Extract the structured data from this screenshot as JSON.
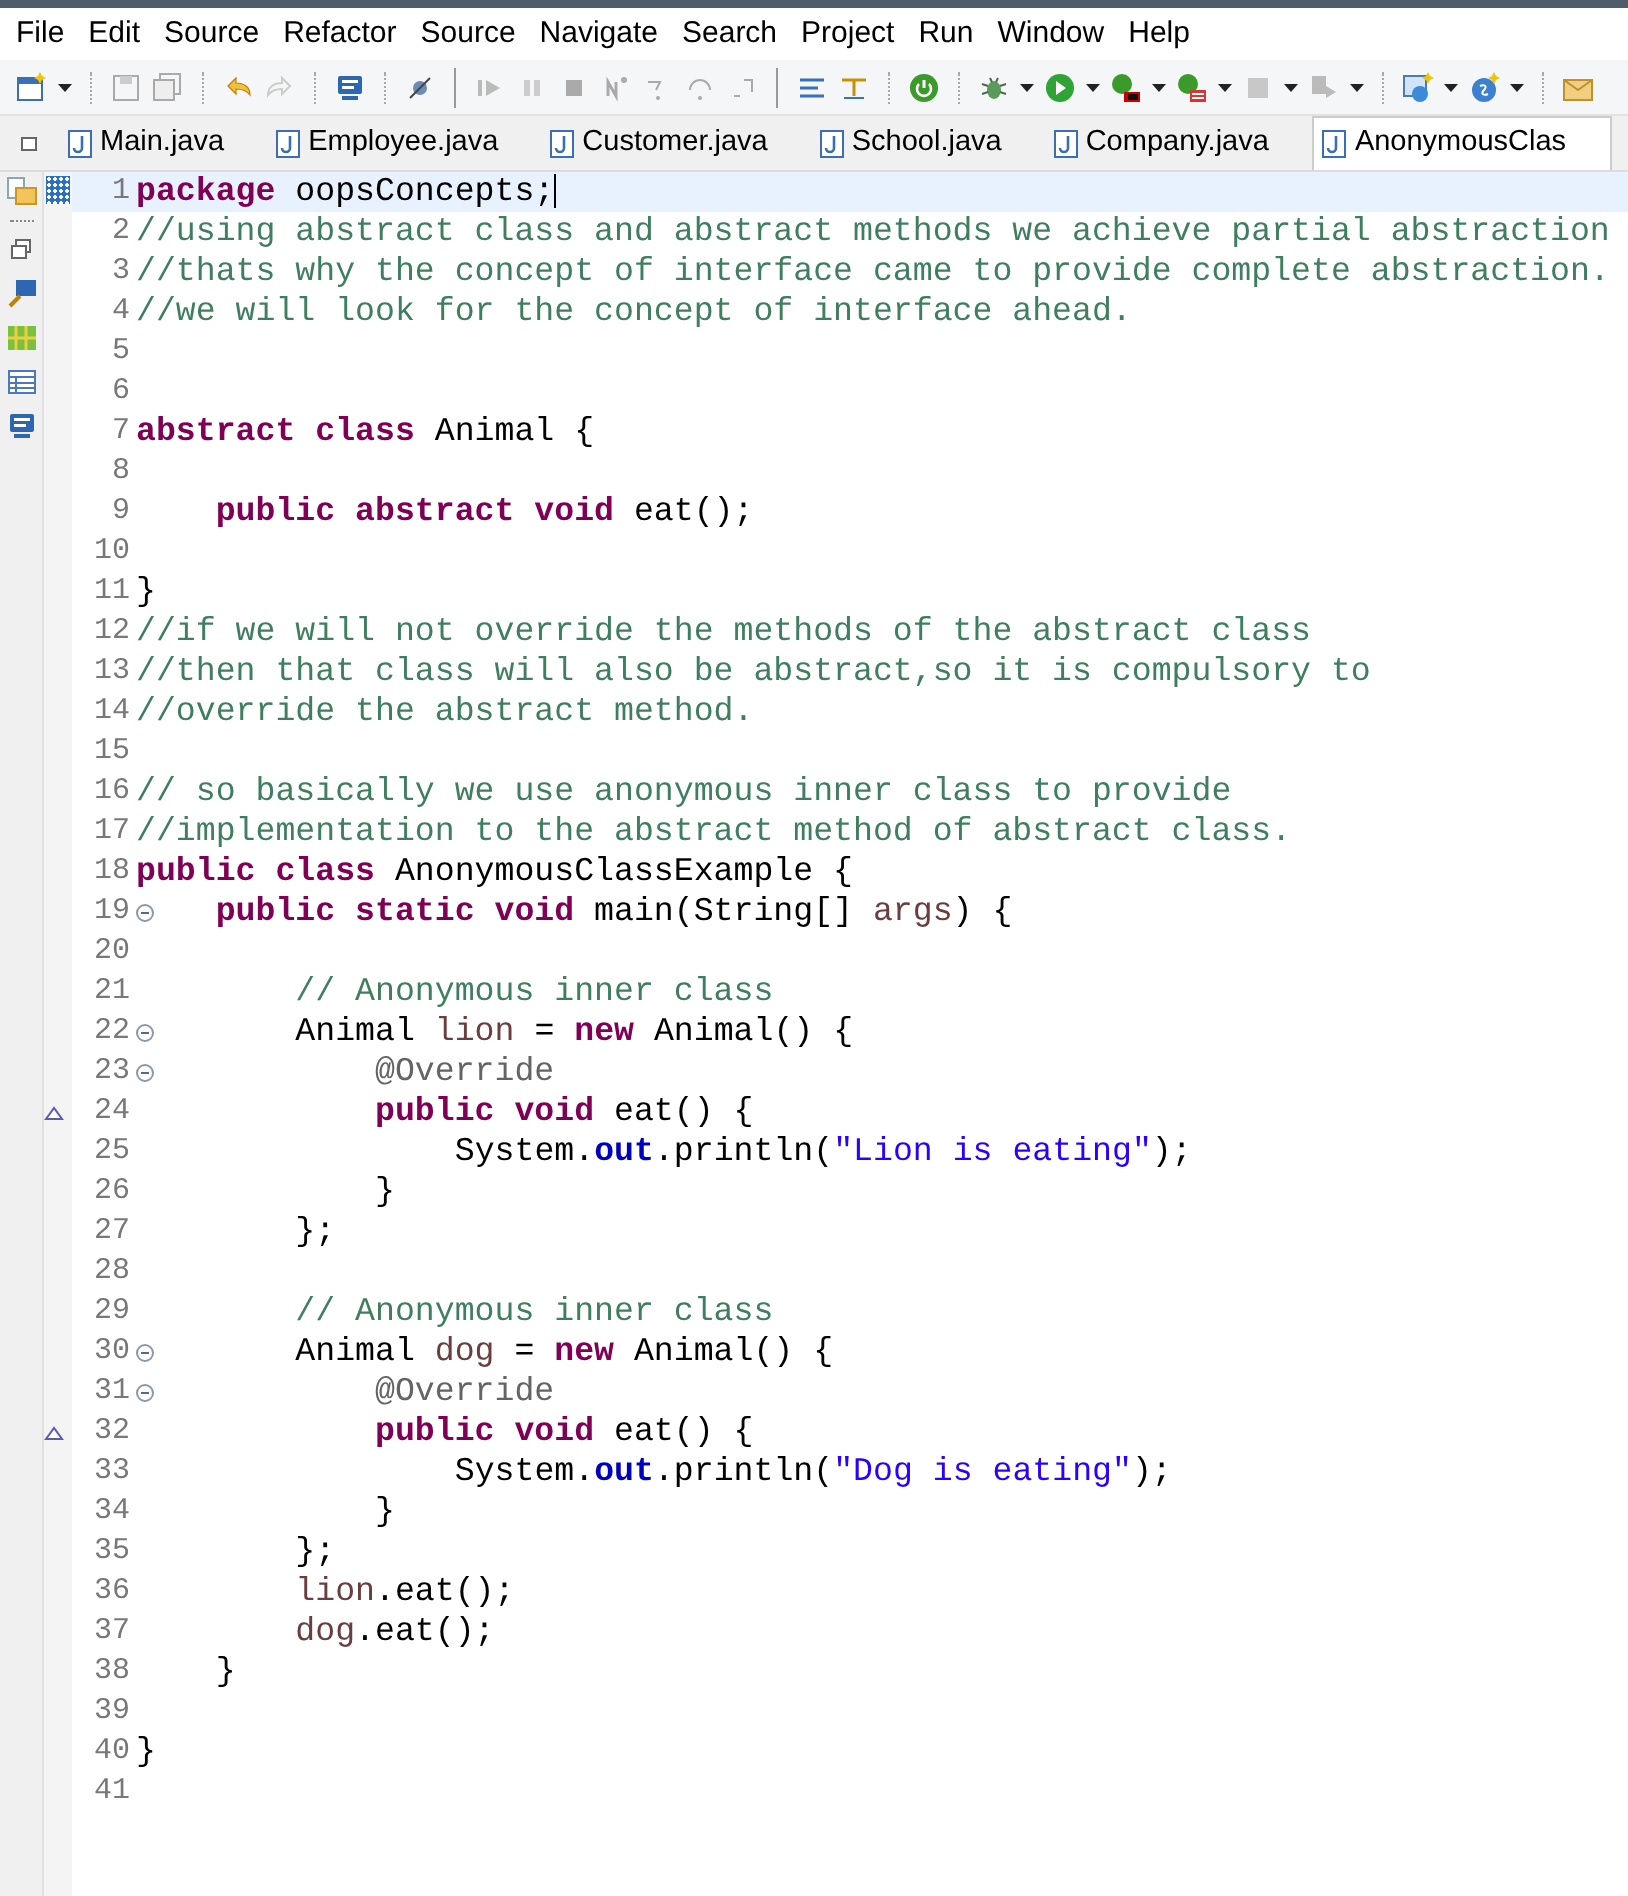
{
  "menu": [
    "File",
    "Edit",
    "Source",
    "Refactor",
    "Source",
    "Navigate",
    "Search",
    "Project",
    "Run",
    "Window",
    "Help"
  ],
  "tabs": [
    {
      "label": "Main.java",
      "selected": false
    },
    {
      "label": "Employee.java",
      "selected": false
    },
    {
      "label": "Customer.java",
      "selected": false
    },
    {
      "label": "School.java",
      "selected": false
    },
    {
      "label": "Company.java",
      "selected": false
    },
    {
      "label": "AnonymousClas",
      "selected": true
    }
  ],
  "editor": {
    "lines": [
      {
        "number": "1",
        "current": true,
        "foldable": false,
        "overrides": false,
        "tokens": [
          {
            "kind": "keyword",
            "text": "package"
          },
          {
            "kind": "plain",
            "text": " oopsConcepts;"
          }
        ]
      },
      {
        "number": "2",
        "current": false,
        "foldable": false,
        "overrides": false,
        "tokens": [
          {
            "kind": "comment",
            "text": "//using abstract class and abstract methods we achieve partial abstraction"
          }
        ]
      },
      {
        "number": "3",
        "current": false,
        "foldable": false,
        "overrides": false,
        "tokens": [
          {
            "kind": "comment",
            "text": "//thats why the concept of interface came to provide complete abstraction."
          }
        ]
      },
      {
        "number": "4",
        "current": false,
        "foldable": false,
        "overrides": false,
        "tokens": [
          {
            "kind": "comment",
            "text": "//we will look for the concept of interface ahead."
          }
        ]
      },
      {
        "number": "5",
        "current": false,
        "foldable": false,
        "overrides": false
      },
      {
        "number": "6",
        "current": false,
        "foldable": false,
        "overrides": false
      },
      {
        "number": "7",
        "current": false,
        "foldable": false,
        "overrides": false,
        "tokens": [
          {
            "kind": "keyword",
            "text": "abstract class"
          },
          {
            "kind": "plain",
            "text": " Animal {"
          }
        ]
      },
      {
        "number": "8",
        "current": false,
        "foldable": false,
        "overrides": false
      },
      {
        "number": "9",
        "current": false,
        "foldable": false,
        "overrides": false,
        "tokens": [
          {
            "kind": "keyword",
            "text": "    public abstract void"
          },
          {
            "kind": "plain",
            "text": " eat();"
          }
        ]
      },
      {
        "number": "10",
        "current": false,
        "foldable": false,
        "overrides": false
      },
      {
        "number": "11",
        "current": false,
        "foldable": false,
        "overrides": false,
        "tokens": [
          {
            "kind": "plain",
            "text": "}"
          }
        ]
      },
      {
        "number": "12",
        "current": false,
        "foldable": false,
        "overrides": false,
        "tokens": [
          {
            "kind": "comment",
            "text": "//if we will not override the methods of the abstract class"
          }
        ]
      },
      {
        "number": "13",
        "current": false,
        "foldable": false,
        "overrides": false,
        "tokens": [
          {
            "kind": "comment",
            "text": "//then that class will also be abstract,so it is compulsory to"
          }
        ]
      },
      {
        "number": "14",
        "current": false,
        "foldable": false,
        "overrides": false,
        "tokens": [
          {
            "kind": "comment",
            "text": "//override the abstract method."
          }
        ]
      },
      {
        "number": "15",
        "current": false,
        "foldable": false,
        "overrides": false
      },
      {
        "number": "16",
        "current": false,
        "foldable": false,
        "overrides": false,
        "tokens": [
          {
            "kind": "comment",
            "text": "// so basically we use anonymous inner class to provide"
          }
        ]
      },
      {
        "number": "17",
        "current": false,
        "foldable": false,
        "overrides": false,
        "tokens": [
          {
            "kind": "comment",
            "text": "//implementation to the abstract method of abstract class."
          }
        ]
      },
      {
        "number": "18",
        "current": false,
        "foldable": false,
        "overrides": false,
        "tokens": [
          {
            "kind": "keyword",
            "text": "public class"
          },
          {
            "kind": "plain",
            "text": " AnonymousClassExample {"
          }
        ]
      },
      {
        "number": "19",
        "current": false,
        "foldable": true,
        "overrides": false,
        "tokens": [
          {
            "kind": "keyword",
            "text": "    public static void"
          },
          {
            "kind": "plain",
            "text": " main(String[] "
          },
          {
            "kind": "variable",
            "text": "args"
          },
          {
            "kind": "plain",
            "text": ") {"
          }
        ]
      },
      {
        "number": "20",
        "current": false,
        "foldable": false,
        "overrides": false
      },
      {
        "number": "21",
        "current": false,
        "foldable": false,
        "overrides": false,
        "tokens": [
          {
            "kind": "comment",
            "text": "        // Anonymous inner class"
          }
        ]
      },
      {
        "number": "22",
        "current": false,
        "foldable": true,
        "overrides": false,
        "tokens": [
          {
            "kind": "plain",
            "text": "        Animal "
          },
          {
            "kind": "variable",
            "text": "lion"
          },
          {
            "kind": "plain",
            "text": " = "
          },
          {
            "kind": "keyword",
            "text": "new"
          },
          {
            "kind": "plain",
            "text": " Animal() {"
          }
        ]
      },
      {
        "number": "23",
        "current": false,
        "foldable": true,
        "overrides": false,
        "tokens": [
          {
            "kind": "annotation",
            "text": "            @Override"
          }
        ]
      },
      {
        "number": "24",
        "current": false,
        "foldable": false,
        "overrides": true,
        "tokens": [
          {
            "kind": "keyword",
            "text": "            public void"
          },
          {
            "kind": "plain",
            "text": " eat() {"
          }
        ]
      },
      {
        "number": "25",
        "current": false,
        "foldable": false,
        "overrides": false,
        "tokens": [
          {
            "kind": "plain",
            "text": "                System."
          },
          {
            "kind": "field",
            "text": "out"
          },
          {
            "kind": "plain",
            "text": ".println("
          },
          {
            "kind": "string",
            "text": "\"Lion is eating\""
          },
          {
            "kind": "plain",
            "text": ");"
          }
        ]
      },
      {
        "number": "26",
        "current": false,
        "foldable": false,
        "overrides": false,
        "tokens": [
          {
            "kind": "plain",
            "text": "            }"
          }
        ]
      },
      {
        "number": "27",
        "current": false,
        "foldable": false,
        "overrides": false,
        "tokens": [
          {
            "kind": "plain",
            "text": "        };"
          }
        ]
      },
      {
        "number": "28",
        "current": false,
        "foldable": false,
        "overrides": false
      },
      {
        "number": "29",
        "current": false,
        "foldable": false,
        "overrides": false,
        "tokens": [
          {
            "kind": "comment",
            "text": "        // Anonymous inner class"
          }
        ]
      },
      {
        "number": "30",
        "current": false,
        "foldable": true,
        "overrides": false,
        "tokens": [
          {
            "kind": "plain",
            "text": "        Animal "
          },
          {
            "kind": "variable",
            "text": "dog"
          },
          {
            "kind": "plain",
            "text": " = "
          },
          {
            "kind": "keyword",
            "text": "new"
          },
          {
            "kind": "plain",
            "text": " Animal() {"
          }
        ]
      },
      {
        "number": "31",
        "current": false,
        "foldable": true,
        "overrides": false,
        "tokens": [
          {
            "kind": "annotation",
            "text": "            @Override"
          }
        ]
      },
      {
        "number": "32",
        "current": false,
        "foldable": false,
        "overrides": true,
        "tokens": [
          {
            "kind": "keyword",
            "text": "            public void"
          },
          {
            "kind": "plain",
            "text": " eat() {"
          }
        ]
      },
      {
        "number": "33",
        "current": false,
        "foldable": false,
        "overrides": false,
        "tokens": [
          {
            "kind": "plain",
            "text": "                System."
          },
          {
            "kind": "field",
            "text": "out"
          },
          {
            "kind": "plain",
            "text": ".println("
          },
          {
            "kind": "string",
            "text": "\"Dog is eating\""
          },
          {
            "kind": "plain",
            "text": ");"
          }
        ]
      },
      {
        "number": "34",
        "current": false,
        "foldable": false,
        "overrides": false,
        "tokens": [
          {
            "kind": "plain",
            "text": "            }"
          }
        ]
      },
      {
        "number": "35",
        "current": false,
        "foldable": false,
        "overrides": false,
        "tokens": [
          {
            "kind": "plain",
            "text": "        };"
          }
        ]
      },
      {
        "number": "36",
        "current": false,
        "foldable": false,
        "overrides": false,
        "tokens": [
          {
            "kind": "variable",
            "text": "        lion"
          },
          {
            "kind": "plain",
            "text": ".eat();"
          }
        ]
      },
      {
        "number": "37",
        "current": false,
        "foldable": false,
        "overrides": false,
        "tokens": [
          {
            "kind": "variable",
            "text": "        dog"
          },
          {
            "kind": "plain",
            "text": ".eat();"
          }
        ]
      },
      {
        "number": "38",
        "current": false,
        "foldable": false,
        "overrides": false,
        "tokens": [
          {
            "kind": "plain",
            "text": "    }"
          }
        ]
      },
      {
        "number": "39",
        "current": false,
        "foldable": false,
        "overrides": false
      },
      {
        "number": "40",
        "current": false,
        "foldable": false,
        "overrides": false,
        "tokens": [
          {
            "kind": "plain",
            "text": "}"
          }
        ]
      },
      {
        "number": "41",
        "current": false,
        "foldable": false,
        "overrides": false
      }
    ]
  }
}
